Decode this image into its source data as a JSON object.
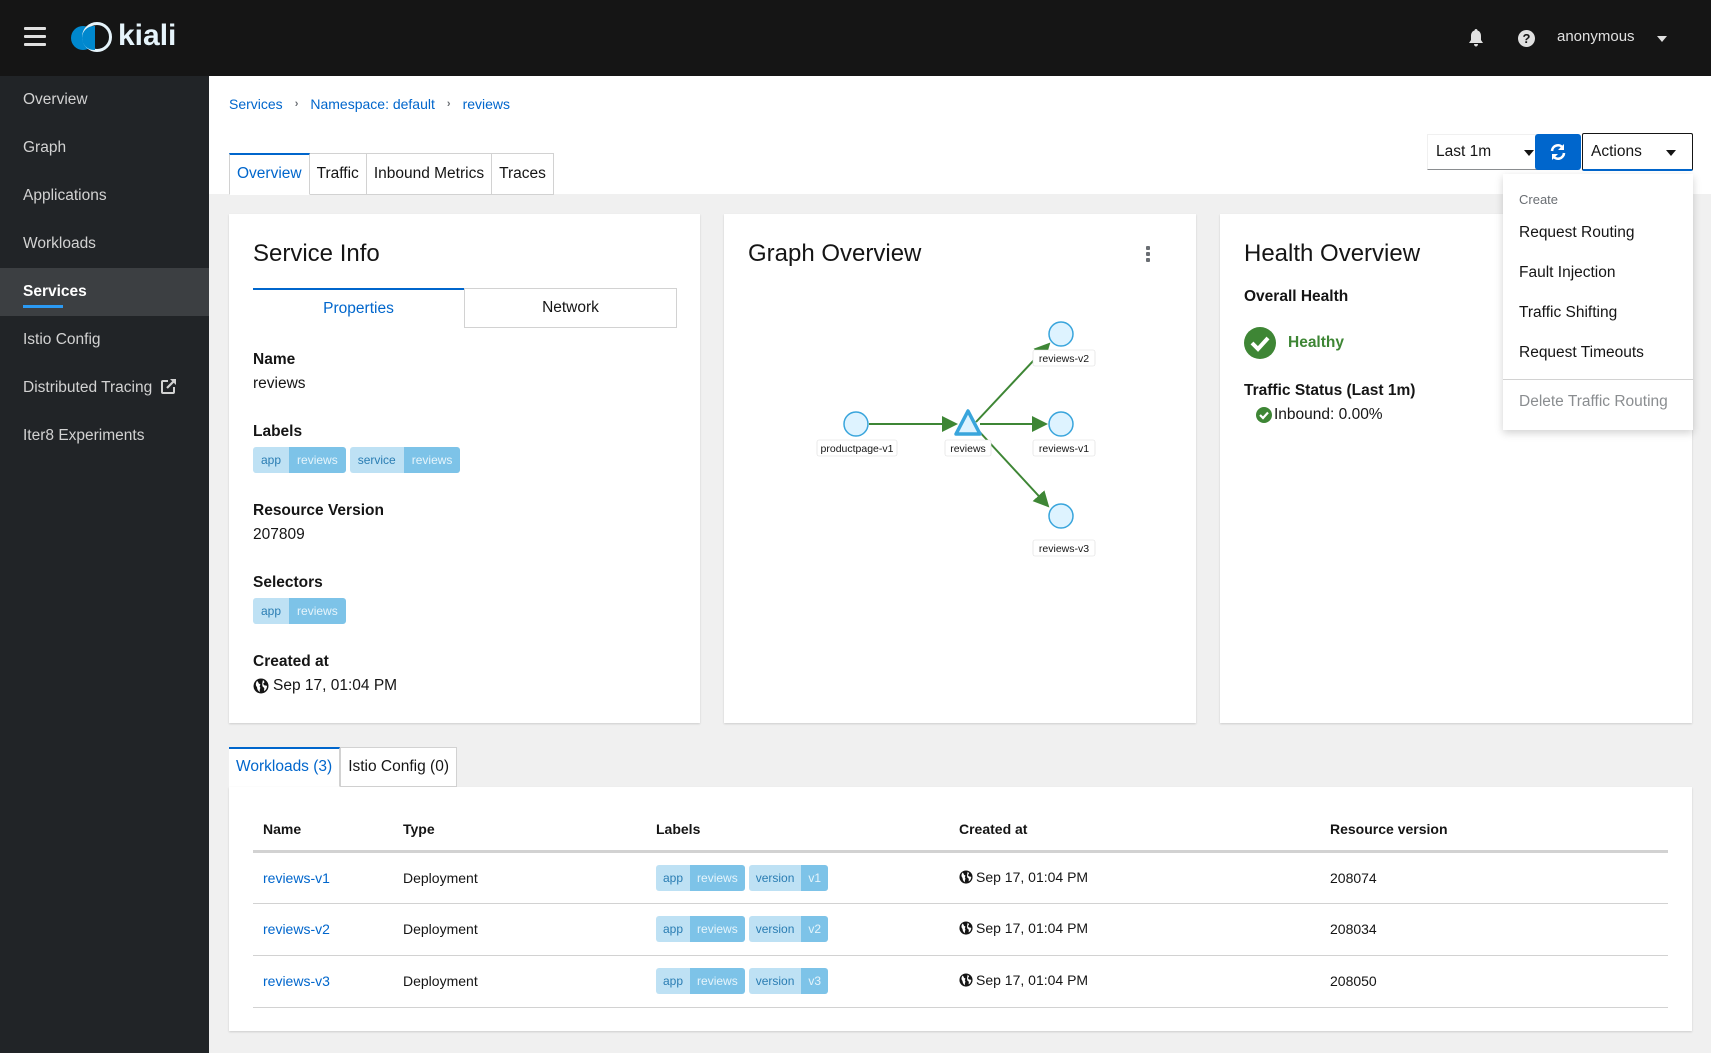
{
  "masthead": {
    "brand": "kiali",
    "user": "anonymous"
  },
  "sidebar": {
    "items": [
      {
        "label": "Overview"
      },
      {
        "label": "Graph"
      },
      {
        "label": "Applications"
      },
      {
        "label": "Workloads"
      },
      {
        "label": "Services",
        "active": true
      },
      {
        "label": "Istio Config"
      },
      {
        "label": "Distributed Tracing",
        "external": true
      },
      {
        "label": "Iter8 Experiments"
      }
    ]
  },
  "breadcrumb": [
    "Services",
    "Namespace: default",
    "reviews"
  ],
  "tabs": [
    "Overview",
    "Traffic",
    "Inbound Metrics",
    "Traces"
  ],
  "toolbar": {
    "time_range": "Last 1m",
    "actions_label": "Actions"
  },
  "actions_menu": {
    "group": "Create",
    "items": [
      "Request Routing",
      "Fault Injection",
      "Traffic Shifting",
      "Request Timeouts"
    ],
    "disabled_item": "Delete Traffic Routing"
  },
  "service_info": {
    "title": "Service Info",
    "tabs": [
      "Properties",
      "Network"
    ],
    "name_label": "Name",
    "name": "reviews",
    "labels_label": "Labels",
    "labels": [
      {
        "key": "app",
        "value": "reviews"
      },
      {
        "key": "service",
        "value": "reviews"
      }
    ],
    "resource_version_label": "Resource Version",
    "resource_version": "207809",
    "selectors_label": "Selectors",
    "selectors": [
      {
        "key": "app",
        "value": "reviews"
      }
    ],
    "created_label": "Created at",
    "created": "Sep 17, 01:04 PM"
  },
  "graph_overview": {
    "title": "Graph Overview",
    "nodes": [
      "productpage-v1",
      "reviews",
      "reviews-v1",
      "reviews-v2",
      "reviews-v3"
    ],
    "colors": {
      "edge": "#3e8635",
      "node_fill": "#def3ff",
      "node_stroke": "#39a5dc"
    }
  },
  "health_overview": {
    "title": "Health Overview",
    "overall_label": "Overall Health",
    "status": "Healthy",
    "traffic_label": "Traffic Status (Last 1m)",
    "inbound": "Inbound: 0.00%",
    "status_color": "#3e8635"
  },
  "bottom_tabs": [
    "Workloads (3)",
    "Istio Config (0)"
  ],
  "workloads": {
    "headers": [
      "Name",
      "Type",
      "Labels",
      "Created at",
      "Resource version"
    ],
    "rows": [
      {
        "name": "reviews-v1",
        "type": "Deployment",
        "labels": [
          {
            "key": "app",
            "value": "reviews"
          },
          {
            "key": "version",
            "value": "v1"
          }
        ],
        "created": "Sep 17, 01:04 PM",
        "version": "208074"
      },
      {
        "name": "reviews-v2",
        "type": "Deployment",
        "labels": [
          {
            "key": "app",
            "value": "reviews"
          },
          {
            "key": "version",
            "value": "v2"
          }
        ],
        "created": "Sep 17, 01:04 PM",
        "version": "208034"
      },
      {
        "name": "reviews-v3",
        "type": "Deployment",
        "labels": [
          {
            "key": "app",
            "value": "reviews"
          },
          {
            "key": "version",
            "value": "v3"
          }
        ],
        "created": "Sep 17, 01:04 PM",
        "version": "208050"
      }
    ]
  }
}
